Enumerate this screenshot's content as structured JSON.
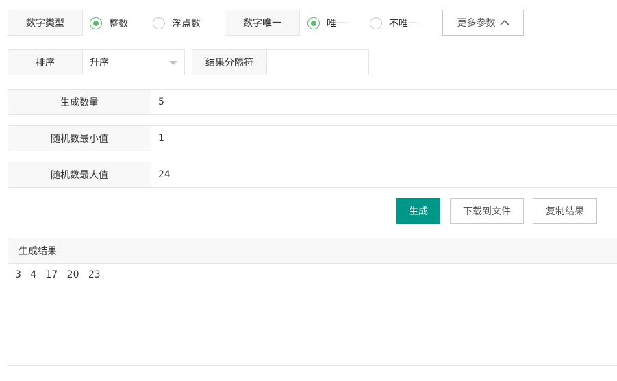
{
  "options": {
    "number_type_label": "数字类型",
    "number_type_options": [
      {
        "label": "整数",
        "selected": true
      },
      {
        "label": "浮点数",
        "selected": false
      }
    ],
    "unique_label": "数字唯一",
    "unique_options": [
      {
        "label": "唯一",
        "selected": true
      },
      {
        "label": "不唯一",
        "selected": false
      }
    ],
    "more_params_button": "更多参数",
    "more_params_icon": "chevron-up-icon"
  },
  "sort": {
    "label": "排序",
    "value": "升序",
    "icon": "caret-down-icon"
  },
  "separator": {
    "label": "结果分隔符",
    "value": ""
  },
  "fields": [
    {
      "label": "生成数量",
      "value": "5"
    },
    {
      "label": "随机数最小值",
      "value": "1"
    },
    {
      "label": "随机数最大值",
      "value": "24"
    }
  ],
  "actions": {
    "generate": "生成",
    "download": "下载到文件",
    "copy": "复制结果"
  },
  "result": {
    "title": "生成结果",
    "content": "3   4   17   20   23"
  },
  "colors": {
    "primary": "#009688",
    "radio_checked": "#5fb878"
  }
}
